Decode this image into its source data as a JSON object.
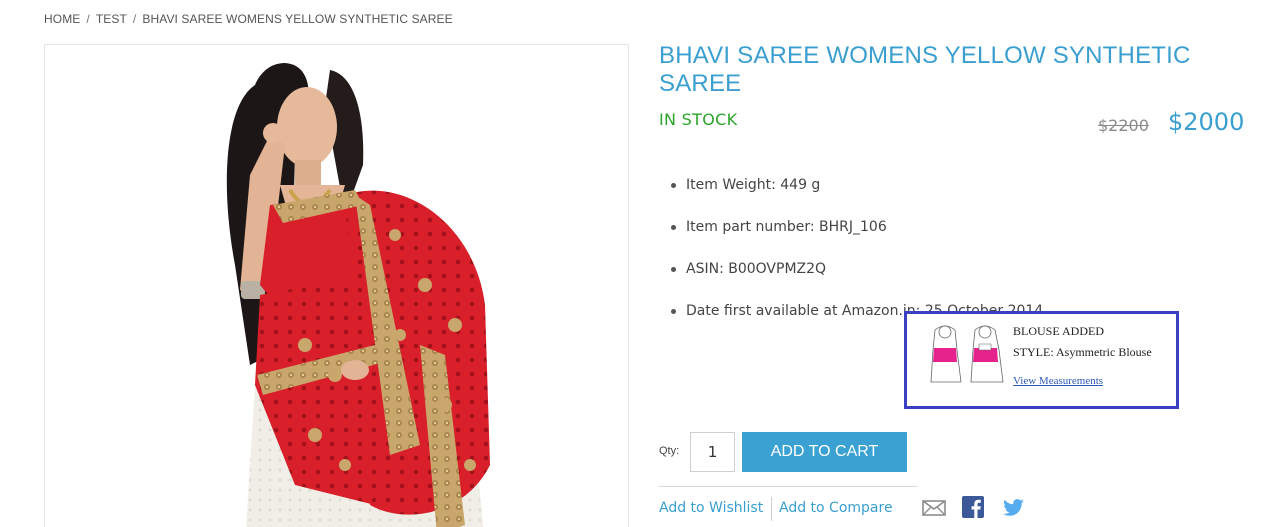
{
  "breadcrumb": {
    "items": [
      "HOME",
      "TEST",
      "BHAVI SAREE WOMENS YELLOW SYNTHETIC SAREE"
    ],
    "separator": "/"
  },
  "product": {
    "title": "BHAVI SAREE WOMENS YELLOW SYNTHETIC SAREE",
    "stock": "IN STOCK",
    "old_price": "$2200",
    "price": "$2000",
    "specs": [
      "Item Weight: 449 g",
      "Item part number: BHRJ_106",
      "ASIN: B00OVPMZ2Q",
      "Date first available at Amazon.in: 25 October 2014"
    ]
  },
  "blouse_popup": {
    "title": "BLOUSE ADDED",
    "style": "STYLE: Asymmetric Blouse",
    "link": "View Measurements"
  },
  "cart": {
    "qty_label": "Qty:",
    "qty_value": "1",
    "add_label": "ADD TO CART"
  },
  "actions": {
    "wishlist": "Add to Wishlist",
    "compare": "Add to Compare"
  },
  "colors": {
    "accent": "#3a9fd0",
    "stock": "#2aa52a",
    "popup_border": "#3b3fc2",
    "saree_red": "#d81f2a"
  },
  "icons": {
    "share": [
      "mail-icon",
      "facebook-icon",
      "twitter-icon"
    ]
  }
}
